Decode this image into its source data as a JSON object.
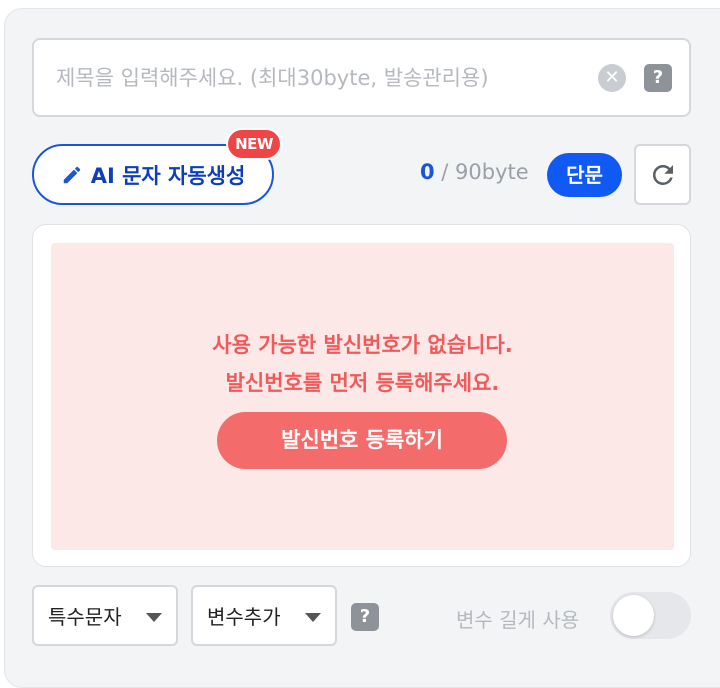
{
  "title_input": {
    "placeholder": "제목을 입력해주세요. (최대30byte, 발송관리용)",
    "value": ""
  },
  "title_actions": {
    "clear_glyph": "✕",
    "help_glyph": "?"
  },
  "ai_button": {
    "label": "AI 문자 자동생성",
    "badge": "NEW"
  },
  "byte_counter": {
    "current": "0",
    "limit_text": " / 90byte"
  },
  "message_type": "단문",
  "alert": {
    "line1": "사용 가능한 발신번호가 없습니다.",
    "line2": "발신번호를 먼저 등록해주세요.",
    "register_button": "발신번호 등록하기"
  },
  "bottom": {
    "special_chars": "특수문자",
    "add_variable": "변수추가",
    "help_glyph": "?",
    "long_variable_label": "변수 길게 사용",
    "long_variable_enabled": false
  },
  "colors": {
    "accent": "#1a56db",
    "badge_red": "#f04545",
    "alert_bg": "#fde8e8",
    "alert_text": "#f05a5a",
    "register_button": "#f46b6b"
  }
}
